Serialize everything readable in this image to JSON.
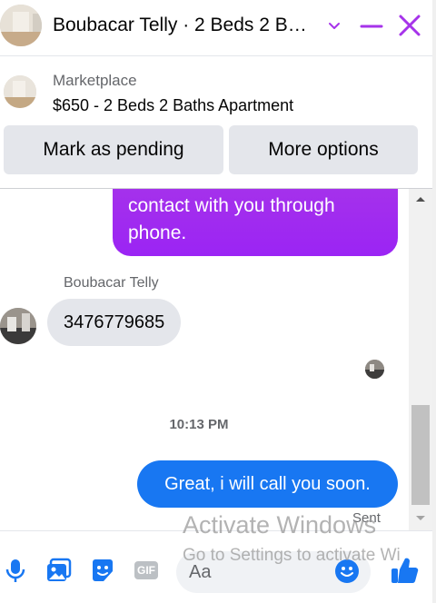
{
  "header": {
    "title": "Boubacar Telly · 2 Beds 2 B…",
    "icons": [
      "chevron-down-icon",
      "minimize-icon",
      "close-icon"
    ],
    "accent_color": "#a633ea"
  },
  "marketplace": {
    "label": "Marketplace",
    "listing_title": "$650 - 2 Beds 2 Baths Apartment",
    "buttons": {
      "mark_pending": "Mark as pending",
      "more_options": "More options"
    }
  },
  "conversation": {
    "messages": [
      {
        "direction": "outgoing",
        "text": "contact with you through phone.",
        "color": "#a633ea"
      },
      {
        "direction": "incoming",
        "sender": "Boubacar Telly",
        "text": "3476779685"
      },
      {
        "direction": "outgoing",
        "text": "Great, i will call you soon.",
        "color": "#1877f2"
      }
    ],
    "timestamp": "10:13 PM",
    "status": "Sent"
  },
  "composer": {
    "placeholder": "Aa",
    "tools": [
      "microphone-icon",
      "image-icon",
      "sticker-icon",
      "gif-icon",
      "emoji-icon",
      "thumbs-up-icon"
    ],
    "gif_label": "GIF",
    "accent_color": "#1877f2"
  },
  "os_watermark": {
    "title": "Activate Windows",
    "subtitle": "Go to Settings to activate Wi"
  }
}
